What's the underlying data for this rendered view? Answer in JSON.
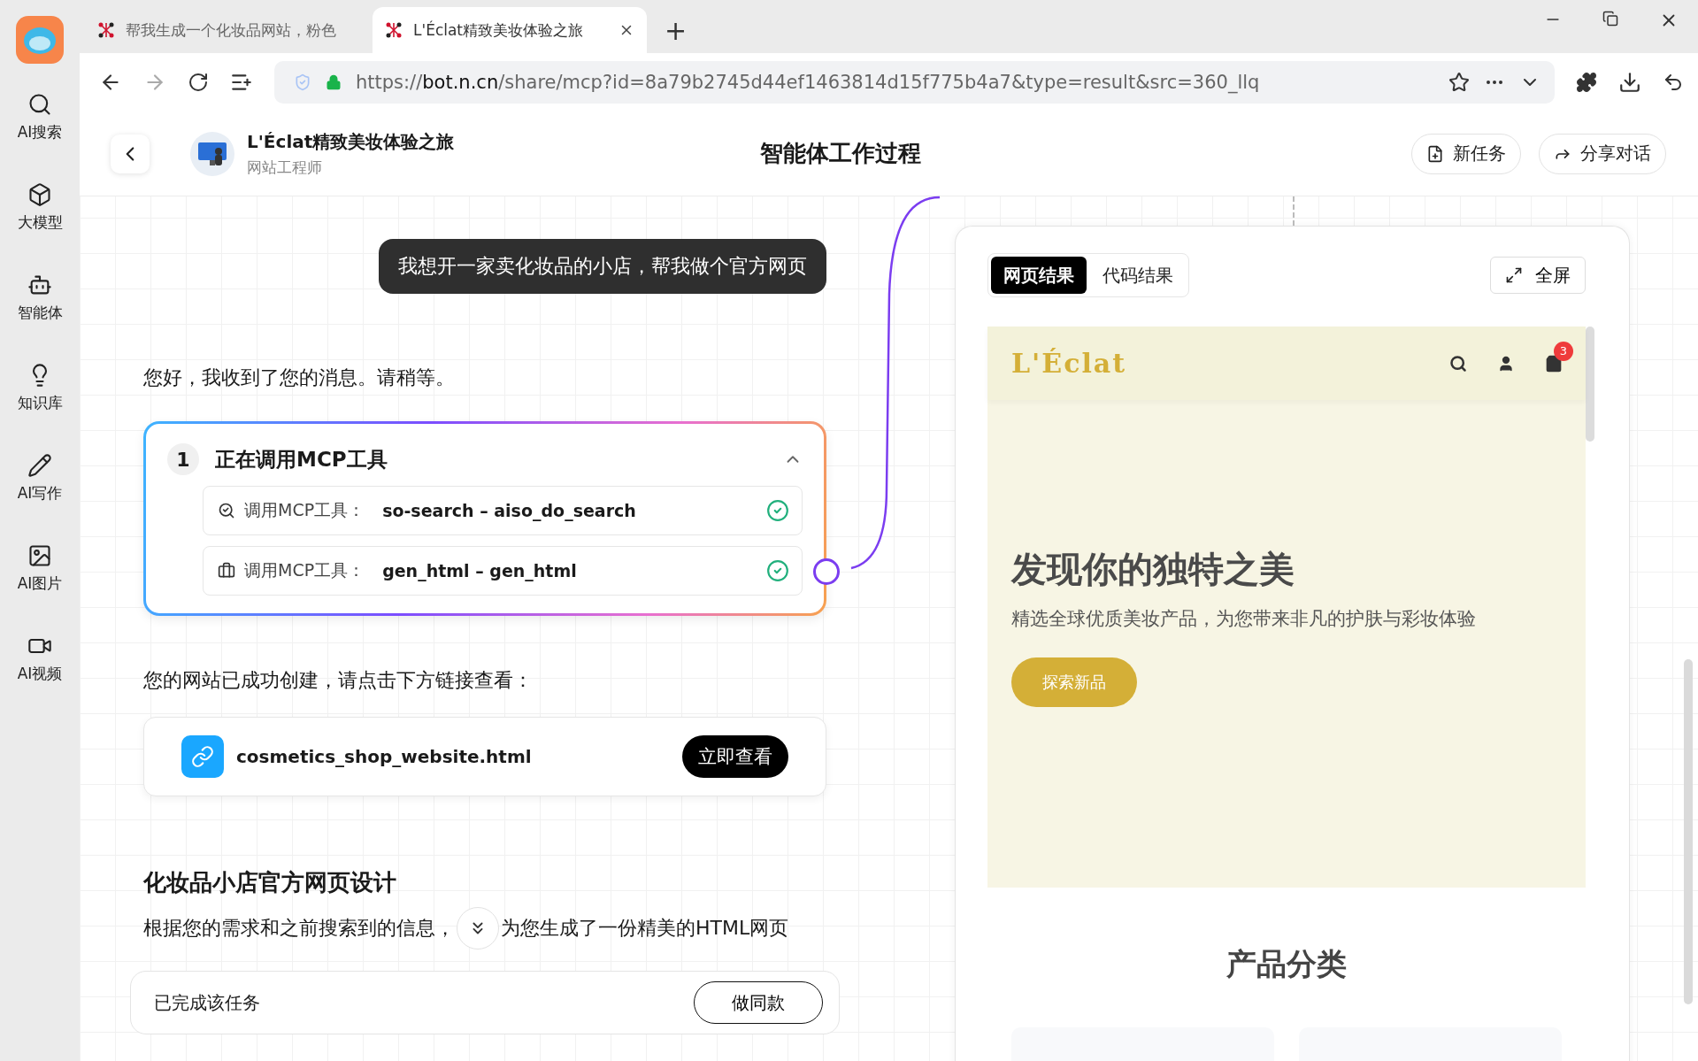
{
  "browser": {
    "tabs": [
      {
        "title": "帮我生成一个化妆品网站，粉色",
        "selected": false
      },
      {
        "title": "L'Éclat精致美妆体验之旅",
        "selected": true
      }
    ],
    "new_tab": "+",
    "url": {
      "scheme": "https://",
      "host": "bot.n.cn",
      "path": "/share/mcp?id=8a79b2745d44ef1463814d15f775b4a7&type=result&src=360_llq"
    }
  },
  "sidebar": {
    "items": [
      {
        "label": "AI搜索"
      },
      {
        "label": "大模型"
      },
      {
        "label": "智能体"
      },
      {
        "label": "知识库"
      },
      {
        "label": "AI写作"
      },
      {
        "label": "AI图片"
      },
      {
        "label": "AI视频"
      }
    ]
  },
  "header": {
    "title": "L'Éclat精致美妆体验之旅",
    "subtitle": "网站工程师",
    "center_title": "智能体工作过程",
    "buttons": [
      {
        "label": "新任务"
      },
      {
        "label": "分享对话"
      }
    ]
  },
  "chat": {
    "user_message": "我想开一家卖化妆品的小店，帮我做个官方网页",
    "reply": "您好，我收到了您的消息。请稍等。",
    "step": {
      "number": "1",
      "title": "正在调用MCP工具",
      "expanded": true,
      "calls": [
        {
          "label": "调用MCP工具：",
          "name": "so-search – aiso_do_search",
          "done": true
        },
        {
          "label": "调用MCP工具：",
          "name": "gen_html – gen_html",
          "done": true
        }
      ]
    },
    "created": "您的网站已成功创建，请点击下方链接查看：",
    "file": {
      "name": "cosmetics_shop_website.html",
      "button": "立即查看"
    },
    "section_title": "化妆品小店官方网页设计",
    "section_text": [
      "根据您的需求和之前搜索到的信息，",
      "为您生成了一份精美的HTML网页"
    ]
  },
  "bottom_bar": {
    "status": "已完成该任务",
    "button": "做同款"
  },
  "preview": {
    "tabs": [
      {
        "label": "网页结果",
        "selected": true
      },
      {
        "label": "代码结果",
        "selected": false
      }
    ],
    "fullscreen": "全屏",
    "site": {
      "logo": "L'Éclat",
      "cart_count": "3",
      "hero_title": "发现你的独特之美",
      "hero_text": "精选全球优质美妆产品，为您带来非凡的护肤与彩妆体验",
      "hero_button": "探索新品",
      "section_title": "产品分类"
    }
  }
}
